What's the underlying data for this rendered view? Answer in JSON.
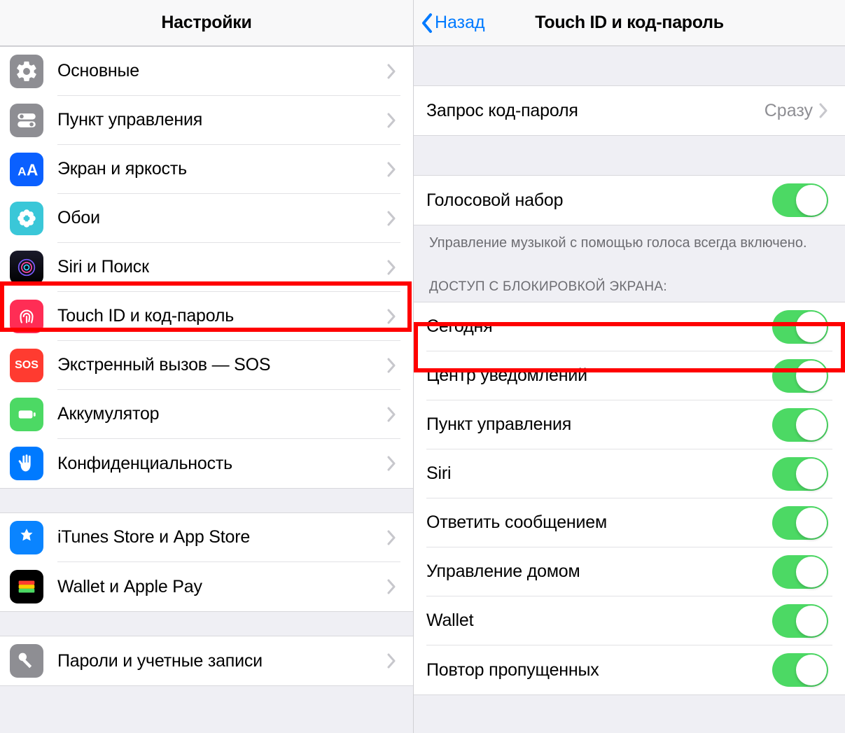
{
  "left": {
    "title": "Настройки",
    "items": [
      {
        "key": "general",
        "label": "Основные"
      },
      {
        "key": "control",
        "label": "Пункт управления"
      },
      {
        "key": "display",
        "label": "Экран и яркость"
      },
      {
        "key": "wallpaper",
        "label": "Обои"
      },
      {
        "key": "siri",
        "label": "Siri и Поиск"
      },
      {
        "key": "touchid",
        "label": "Touch ID и код-пароль"
      },
      {
        "key": "sos",
        "label": "Экстренный вызов — SOS"
      },
      {
        "key": "battery",
        "label": "Аккумулятор"
      },
      {
        "key": "privacy",
        "label": "Конфиденциальность"
      },
      {
        "key": "itunes",
        "label": "iTunes Store и App Store"
      },
      {
        "key": "wallet",
        "label": "Wallet и Apple Pay"
      },
      {
        "key": "passwords",
        "label": "Пароли и учетные записи"
      }
    ]
  },
  "right": {
    "back": "Назад",
    "title": "Touch ID и код-пароль",
    "passcode": {
      "label": "Запрос код-пароля",
      "value": "Сразу"
    },
    "voiceDial": {
      "label": "Голосовой набор",
      "on": true
    },
    "voiceDialFooter": "Управление музыкой с помощью голоса всегда включено.",
    "lockHeader": "ДОСТУП С БЛОКИРОВКОЙ ЭКРАНА:",
    "lockItems": [
      {
        "key": "today",
        "label": "Сегодня",
        "on": true
      },
      {
        "key": "notif",
        "label": "Центр уведомлений",
        "on": true
      },
      {
        "key": "control",
        "label": "Пункт управления",
        "on": true
      },
      {
        "key": "siri",
        "label": "Siri",
        "on": true
      },
      {
        "key": "reply",
        "label": "Ответить сообщением",
        "on": true
      },
      {
        "key": "home",
        "label": "Управление домом",
        "on": true
      },
      {
        "key": "wallet",
        "label": "Wallet",
        "on": true
      },
      {
        "key": "missed",
        "label": "Повтор пропущенных",
        "on": true
      }
    ]
  }
}
